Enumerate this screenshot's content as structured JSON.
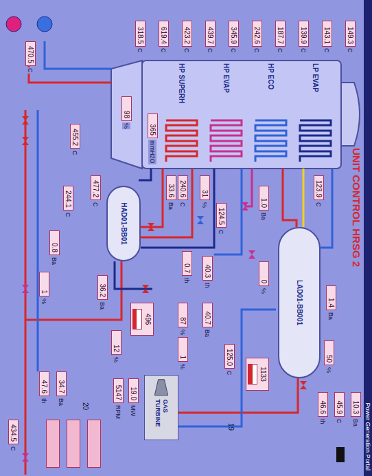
{
  "header": {
    "app": "Power Generation Portal"
  },
  "title": "UNIT CONTROL HRSG 2",
  "duct": {
    "sections": [
      "LP EVAP",
      "HP ECO",
      "HP EVAP",
      "HP SUPERH"
    ]
  },
  "gas_temps": [
    {
      "value": "149.3",
      "unit": "C"
    },
    {
      "value": "143.1",
      "unit": "C"
    },
    {
      "value": "139.9",
      "unit": "C"
    },
    {
      "value": "187.7",
      "unit": "C"
    },
    {
      "value": "242.6",
      "unit": "C"
    },
    {
      "value": "345.9",
      "unit": "C"
    },
    {
      "value": "439.7",
      "unit": "C"
    },
    {
      "value": "423.2",
      "unit": "C"
    },
    {
      "value": "619.4",
      "unit": "C"
    },
    {
      "value": "318.5",
      "unit": "C"
    }
  ],
  "readings": [
    {
      "value": "33.6",
      "unit": "Ba"
    },
    {
      "value": "240.6",
      "unit": "C"
    },
    {
      "value": "31",
      "unit": "%"
    },
    {
      "value": "123.9",
      "unit": "C"
    },
    {
      "value": "1.0",
      "unit": "Ba"
    },
    {
      "value": "1.4",
      "unit": "Ba"
    },
    {
      "value": "0",
      "unit": "%"
    },
    {
      "value": "124.5",
      "unit": "C"
    },
    {
      "value": "244.1",
      "unit": "C"
    },
    {
      "value": "477.2",
      "unit": "C"
    },
    {
      "value": "0.8",
      "unit": "Ba"
    },
    {
      "value": "1",
      "unit": "%"
    },
    {
      "value": "36.2",
      "unit": "Ba"
    },
    {
      "value": "0.7",
      "unit": "th"
    },
    {
      "value": "40.3",
      "unit": "th"
    },
    {
      "value": "40.7",
      "unit": "Ba"
    },
    {
      "value": "87",
      "unit": "%"
    },
    {
      "value": "1",
      "unit": "%"
    },
    {
      "value": "12",
      "unit": "%"
    },
    {
      "value": "125.0",
      "unit": "C"
    },
    {
      "value": "50",
      "unit": "%"
    },
    {
      "value": "10.3",
      "unit": "Ba"
    },
    {
      "value": "45.9",
      "unit": "C"
    },
    {
      "value": "46.6",
      "unit": "th"
    },
    {
      "value": "34.7",
      "unit": "Ba"
    },
    {
      "value": "47.6",
      "unit": "th"
    },
    {
      "value": "434.5",
      "unit": "C"
    },
    {
      "value": "470.5",
      "unit": "C"
    },
    {
      "value": "455.2",
      "unit": "C"
    },
    {
      "value": "98",
      "unit": "%"
    },
    {
      "value": "365",
      "unit": "mmH2O"
    }
  ],
  "drums": [
    {
      "name": "LAD01-BB001",
      "level_reading": "1133",
      "level": 0.5
    },
    {
      "name": "HAD01-BB01",
      "level_reading": "496",
      "level": 0.45
    }
  ],
  "indicators": [
    {
      "color": "#e0207a"
    },
    {
      "color": "#3a6fe0"
    }
  ],
  "turbine": {
    "label": "GAS TURBINE",
    "power": {
      "value": "19.0",
      "unit": "MW"
    },
    "speed": {
      "value": "5147",
      "unit": "RPM"
    }
  },
  "markers": [
    "19",
    "20"
  ]
}
